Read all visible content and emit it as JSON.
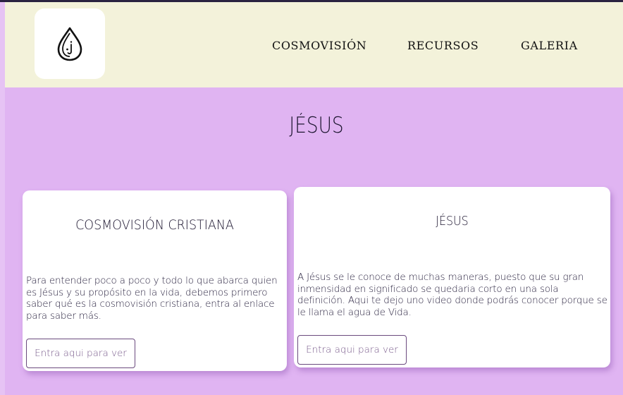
{
  "header": {
    "logo_icon": "water-drop-icon",
    "nav": [
      {
        "label": "COSMOVISIÓN"
      },
      {
        "label": "RECURSOS"
      },
      {
        "label": "GALERIA"
      }
    ]
  },
  "main": {
    "title": "JÉSUS",
    "cards": [
      {
        "title": "COSMOVISIÓN CRISTIANA",
        "text": "Para entender poco a poco y todo lo que abarca quien es Jésus y su propósito en la vida, debemos primero saber qué es la cosmovisión cristiana, entra al enlace para saber más.",
        "button": "Entra aqui para ver"
      },
      {
        "title": "JÉSUS",
        "text": "A Jésus se le conoce de muchas maneras, puesto que su gran inmensidad en significado se quedaria corto en una sola definición. Aqui te dejo uno video donde podrás conocer porque se le llama el agua de Vida.",
        "button": "Entra aqui para ver"
      }
    ]
  },
  "colors": {
    "background": "#e0b4f2",
    "header": "#f3f2da",
    "card": "#ffffff",
    "button_border": "#6b4a7e"
  }
}
